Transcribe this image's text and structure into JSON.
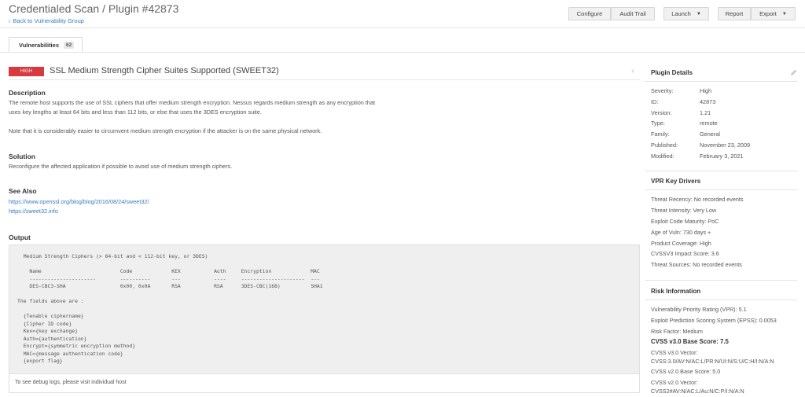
{
  "header": {
    "title": "Credentialed Scan / Plugin #42873",
    "back_label": "Back to Vulnerability Group",
    "back_icon": "chevron-left-icon",
    "buttons": {
      "configure": "Configure",
      "audit_trail": "Audit Trail",
      "launch": "Launch",
      "report": "Report",
      "export": "Export"
    }
  },
  "tabs": [
    {
      "label": "Vulnerabilities",
      "count": "62"
    }
  ],
  "plugin": {
    "severity": "HIGH",
    "severity_color": "#d9383f",
    "title": "SSL Medium Strength Cipher Suites Supported (SWEET32)"
  },
  "description": {
    "heading": "Description",
    "line1": "The remote host supports the use of SSL ciphers that offer medium strength encryption. Nessus regards medium strength as any encryption that",
    "line2": "uses key lengths at least 64 bits and less than 112 bits, or else that uses the 3DES encryption suite.",
    "line3": "Note that it is considerably easier to circumvent medium strength encryption if the attacker is on the same physical network."
  },
  "solution": {
    "heading": "Solution",
    "text": "Reconfigure the affected application if possible to avoid use of medium strength ciphers."
  },
  "see_also": {
    "heading": "See Also",
    "links": [
      "https://www.openssl.org/blog/blog/2016/08/24/sweet32/",
      "https://sweet32.info"
    ]
  },
  "output": {
    "heading": "Output",
    "text": "  Medium Strength Ciphers (> 64-bit and < 112-bit key, or 3DES)\n\n    Name                          Code             KEX           Auth     Encryption             MAC\n    ----------------------        ----------       ---           ----     ---------------------  ---\n    DES-CBC3-SHA                  0x00, 0x0A       RSA           RSA      3DES-CBC(168)          SHA1\n\nThe fields above are :\n\n  {Tenable ciphername}\n  {Cipher ID code}\n  Kex={key exchange}\n  Auth={authentication}\n  Encrypt={symmetric encryption method}\n  MAC={message authentication code}\n  {export flag}",
    "footer": "To see debug logs, please visit individual host"
  },
  "plugin_details": {
    "heading": "Plugin Details",
    "edit_icon": "pencil-icon",
    "rows": [
      {
        "key": "Severity:",
        "value": "High"
      },
      {
        "key": "ID:",
        "value": "42873"
      },
      {
        "key": "Version:",
        "value": "1.21"
      },
      {
        "key": "Type:",
        "value": "remote"
      },
      {
        "key": "Family:",
        "value": "General"
      },
      {
        "key": "Published:",
        "value": "November 23, 2009"
      },
      {
        "key": "Modified:",
        "value": "February 3, 2021"
      }
    ]
  },
  "vpr": {
    "heading": "VPR Key Drivers",
    "items": [
      "Threat Recency: No recorded events",
      "Threat Intensity: Very Low",
      "Exploit Code Maturity: PoC",
      "Age of Vuln: 730 days +",
      "Product Coverage: High",
      "CVSSV3 Impact Score: 3.6",
      "Threat Sources: No recorded events"
    ]
  },
  "risk": {
    "heading": "Risk Information",
    "vpr_rating": "Vulnerability Priority Rating (VPR): 5.1",
    "epss": "Exploit Prediction Scoring System (EPSS): 0.0053",
    "risk_factor": "Risk Factor: Medium",
    "cvss3_base": "CVSS v3.0 Base Score: 7.5",
    "cvss3_vector_label": "CVSS v3.0 Vector:",
    "cvss3_vector": "CVSS:3.0/AV:N/AC:L/PR:N/UI:N/S:U/C:H/I:N/A:N",
    "cvss2_base": "CVSS v2.0 Base Score: 5.0",
    "cvss2_vector_label": "CVSS v2.0 Vector:",
    "cvss2_vector": "CVSS2#AV:N/AC:L/Au:N/C:P/I:N/A:N"
  }
}
